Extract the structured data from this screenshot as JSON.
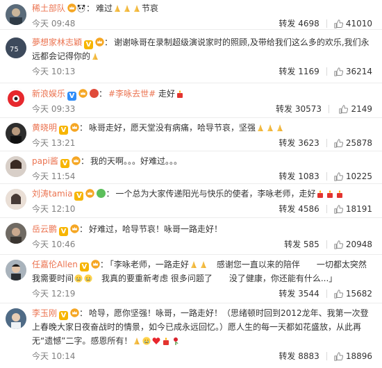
{
  "comments": [
    {
      "name": "稀土部队",
      "text": "难过",
      "tail": "节哀",
      "time": "今天 09:48",
      "repost_label": "转发",
      "reposts": "4698",
      "likes": "41010"
    },
    {
      "name": "夢想家林志穎",
      "text": "谢谢咏哥在录制超级演说家时的照顾,及带给我们这么多的欢乐,我们永远都会记得你的",
      "time": "今天 10:13",
      "repost_label": "转发",
      "reposts": "1169",
      "likes": "36214"
    },
    {
      "name": "新浪娱乐",
      "topic": "#李咏去世#",
      "text": "走好",
      "time": "今天 09:33",
      "repost_label": "转发",
      "reposts": "30573",
      "likes": "2149"
    },
    {
      "name": "黄晓明",
      "text": "咏哥走好，愿天堂没有病痛，哈导节哀，坚强",
      "time": "今天 13:21",
      "repost_label": "转发",
      "reposts": "3623",
      "likes": "25878"
    },
    {
      "name": "papi酱",
      "text": "我的天啊。。。好难过。。。",
      "time": "今天 11:54",
      "repost_label": "转发",
      "reposts": "1083",
      "likes": "10225"
    },
    {
      "name": "刘涛tamia",
      "text": "一个总为大家传递阳光与快乐的使者，李咏老师，走好",
      "time": "今天 12:10",
      "repost_label": "转发",
      "reposts": "4586",
      "likes": "18191"
    },
    {
      "name": "岳云鹏",
      "text": "好难过，哈导节哀！咏哥一路走好！",
      "time": "今天 10:46",
      "repost_label": "转发",
      "reposts": "585",
      "likes": "20948"
    },
    {
      "name": "任嘉伦Allen",
      "text": "「李咏老师，一路走好",
      "text2": "感谢您一直以来的陪伴　　一切都太突然　　我需要时间",
      "text3": "我真的要重新考虑 很多问题了　　没了健康，你还能有什么...」",
      "time": "今天 12:19",
      "repost_label": "转发",
      "reposts": "3544",
      "likes": "15682"
    },
    {
      "name": "李玉刚",
      "text": "哈导，愿你坚强！咏哥，一路走好！（思绪顿时回到2012龙年、我第一次登上春晚大家日夜奋战时的情景，如今已成永远回忆。）愿人生的每一天都如花盛放，从此再无“遗憾”二字。感恩所有！",
      "time": "今天 10:14",
      "repost_label": "转发",
      "reposts": "8883",
      "likes": "18896"
    }
  ],
  "colors": {
    "name": "#eb7350",
    "vip_gold": "#f7b500",
    "verified_blue": "#2f8df8",
    "divider": "#ececec",
    "time": "#808080"
  }
}
